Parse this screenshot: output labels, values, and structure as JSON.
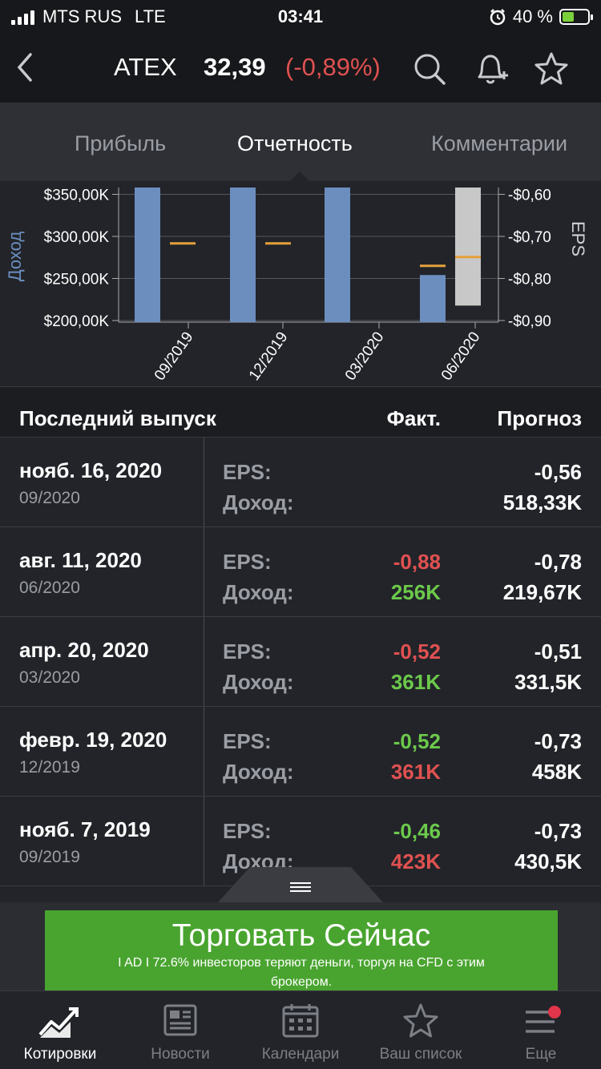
{
  "status": {
    "carrier": "MTS RUS",
    "network": "LTE",
    "time": "03:41",
    "battery": "40 %"
  },
  "header": {
    "ticker": "ATEX",
    "price": "32,39",
    "change": "(-0,89%)"
  },
  "tabs": [
    {
      "label": "Прибыль"
    },
    {
      "label": "Отчетность"
    },
    {
      "label": "Комментарии"
    }
  ],
  "chart_data": {
    "type": "bar",
    "categories": [
      "09/2019",
      "12/2019",
      "03/2020",
      "06/2020"
    ],
    "left_axis_label": "Доход",
    "right_axis_label": "EPS",
    "left_ticks": [
      "$350,00K",
      "$300,00K",
      "$250,00K",
      "$200,00K"
    ],
    "right_ticks": [
      "-$0,60",
      "-$0,70",
      "-$0,80",
      "-$0,90"
    ],
    "ylim": [
      200,
      360
    ],
    "eps_lim": [
      -0.9,
      -0.6
    ],
    "series": [
      {
        "name": "Доход",
        "values": [
          423,
          361,
          361,
          256
        ],
        "colors": [
          "#6c8ebf",
          "#6c8ebf",
          "#6c8ebf",
          "#6c8ebf"
        ]
      },
      {
        "name": "EPS",
        "values": [
          -0.73,
          -0.73,
          -0.51,
          -0.78
        ]
      }
    ],
    "forecast_revenue": [
      430.5,
      458,
      331.5,
      219.67
    ],
    "actual_eps": [
      -0.46,
      -0.52,
      -0.52,
      -0.88
    ],
    "colors": {
      "bar": "#6c8ebf",
      "forecast_bar": "#c8c8c8",
      "eps_marker": "#e5a13a",
      "grid": "#55575d"
    }
  },
  "table": {
    "headers": {
      "release": "Последний выпуск",
      "actual": "Факт.",
      "forecast": "Прогноз"
    },
    "eps_label": "EPS:",
    "rev_label": "Доход:",
    "rows": [
      {
        "date": "нояб. 16, 2020",
        "period": "09/2020",
        "eps_act": "",
        "rev_act": "",
        "eps_fc": "-0,56",
        "rev_fc": "518,33K",
        "eps_color": "",
        "rev_color": ""
      },
      {
        "date": "авг. 11, 2020",
        "period": "06/2020",
        "eps_act": "-0,88",
        "rev_act": "256K",
        "eps_fc": "-0,78",
        "rev_fc": "219,67K",
        "eps_color": "red",
        "rev_color": "green"
      },
      {
        "date": "апр. 20, 2020",
        "period": "03/2020",
        "eps_act": "-0,52",
        "rev_act": "361K",
        "eps_fc": "-0,51",
        "rev_fc": "331,5K",
        "eps_color": "red",
        "rev_color": "green"
      },
      {
        "date": "февр. 19, 2020",
        "period": "12/2019",
        "eps_act": "-0,52",
        "rev_act": "361K",
        "eps_fc": "-0,73",
        "rev_fc": "458K",
        "eps_color": "green",
        "rev_color": "red"
      },
      {
        "date": "нояб. 7, 2019",
        "period": "09/2019",
        "eps_act": "-0,46",
        "rev_act": "423K",
        "eps_fc": "-0,73",
        "rev_fc": "430,5K",
        "eps_color": "green",
        "rev_color": "red"
      }
    ]
  },
  "ad": {
    "title": "Торговать Сейчас",
    "subtitle": "I AD I 72.6% инвесторов теряют деньги, торгуя на CFD с этим брокером."
  },
  "nav": [
    {
      "label": "Котировки",
      "icon": "chart-trend-icon"
    },
    {
      "label": "Новости",
      "icon": "newspaper-icon"
    },
    {
      "label": "Календари",
      "icon": "calendar-icon"
    },
    {
      "label": "Ваш список",
      "icon": "star-icon"
    },
    {
      "label": "Еще",
      "icon": "menu-icon"
    }
  ]
}
